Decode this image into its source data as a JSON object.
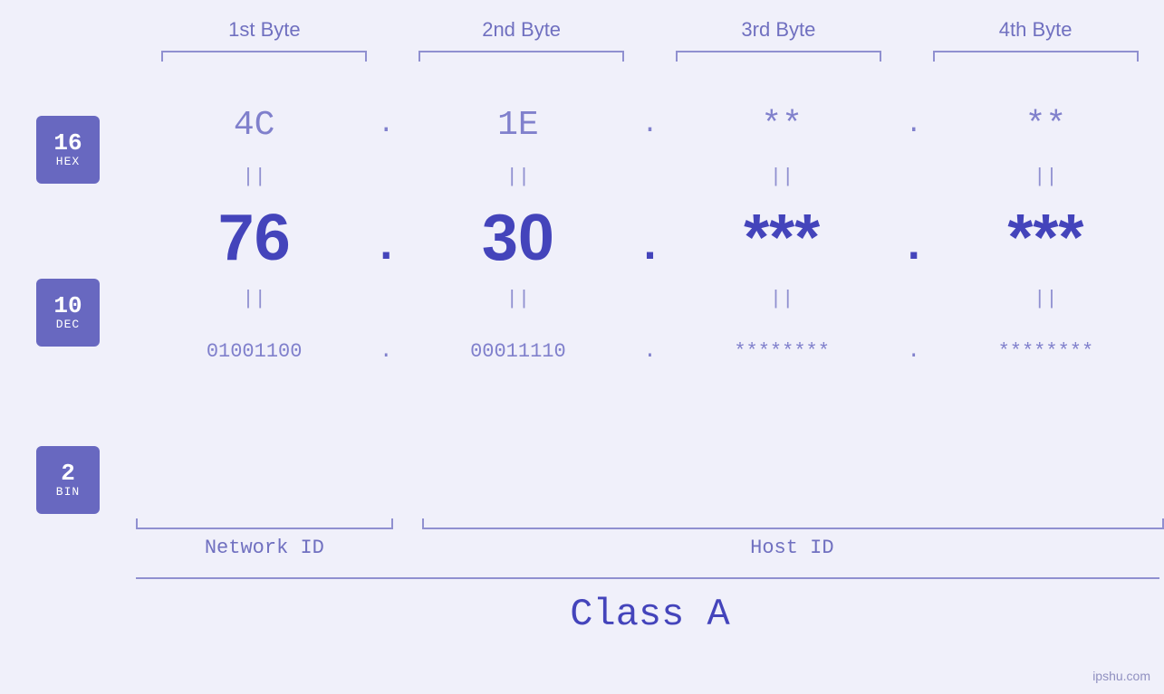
{
  "headers": {
    "byte1": "1st Byte",
    "byte2": "2nd Byte",
    "byte3": "3rd Byte",
    "byte4": "4th Byte"
  },
  "badges": {
    "hex": {
      "number": "16",
      "label": "HEX"
    },
    "dec": {
      "number": "10",
      "label": "DEC"
    },
    "bin": {
      "number": "2",
      "label": "BIN"
    }
  },
  "hex_row": {
    "byte1": "4C",
    "byte2": "1E",
    "byte3": "**",
    "byte4": "**",
    "dots": [
      ".",
      ".",
      ".",
      ""
    ]
  },
  "dec_row": {
    "byte1": "76",
    "byte2": "30",
    "byte3": "***",
    "byte4": "***",
    "dots": [
      ".",
      ".",
      ".",
      ""
    ]
  },
  "bin_row": {
    "byte1": "01001100",
    "byte2": "00011110",
    "byte3": "********",
    "byte4": "********",
    "dots": [
      ".",
      ".",
      ".",
      ""
    ]
  },
  "equals": "||",
  "labels": {
    "network_id": "Network ID",
    "host_id": "Host ID",
    "class": "Class A"
  },
  "watermark": "ipshu.com"
}
